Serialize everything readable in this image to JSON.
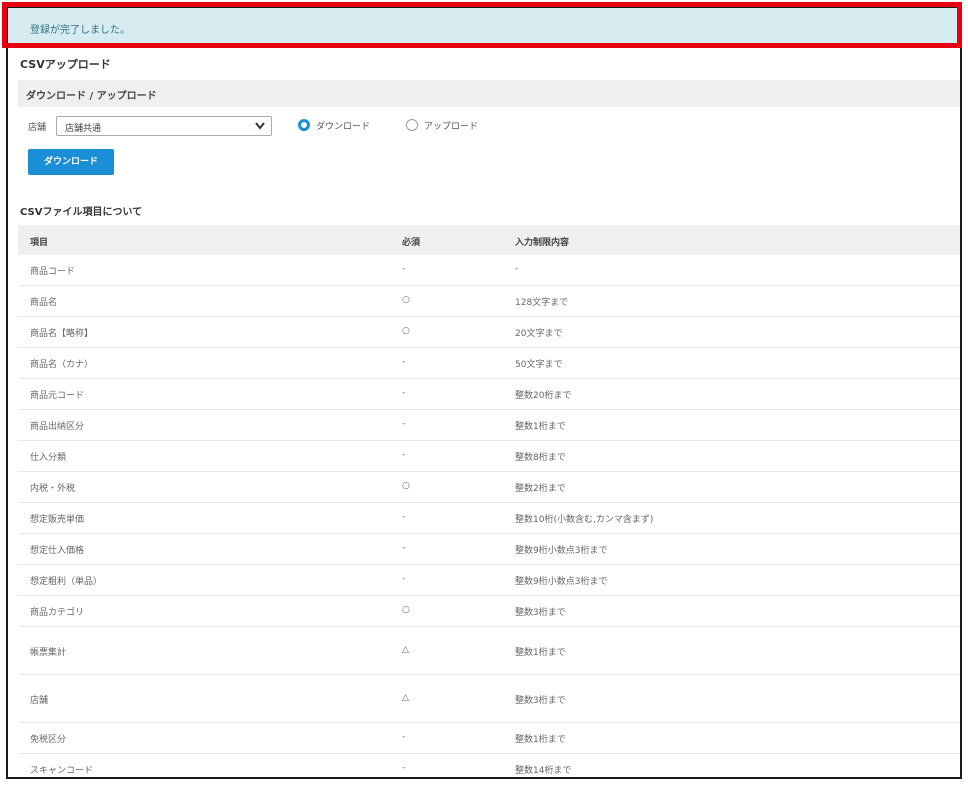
{
  "alert": {
    "message": "登録が完了しました。"
  },
  "page": {
    "title": "CSVアップロード"
  },
  "section": {
    "title": "ダウンロード / アップロード"
  },
  "controls": {
    "store_label": "店舗",
    "store_value": "店舗共通",
    "radio_download": "ダウンロード",
    "radio_upload": "アップロード",
    "selected": "download",
    "download_button": "ダウンロード"
  },
  "spec": {
    "title": "CSVファイル項目について",
    "headers": [
      "項目",
      "必須",
      "入力制限内容"
    ],
    "rows": [
      {
        "item": "商品コード",
        "req": "-",
        "limit": "-"
      },
      {
        "item": "商品名",
        "req": "○",
        "limit": "128文字まで"
      },
      {
        "item": "商品名【略称】",
        "req": "○",
        "limit": "20文字まで"
      },
      {
        "item": "商品名（カナ）",
        "req": "-",
        "limit": "50文字まで"
      },
      {
        "item": "商品元コード",
        "req": "-",
        "limit": "整数20桁まで"
      },
      {
        "item": "商品出納区分",
        "req": "-",
        "limit": "整数1桁まで"
      },
      {
        "item": "仕入分類",
        "req": "-",
        "limit": "整数8桁まで"
      },
      {
        "item": "内税・外税",
        "req": "○",
        "limit": "整数2桁まで"
      },
      {
        "item": "想定販売単価",
        "req": "-",
        "limit": "整数10桁(小数含む,カンマ含まず)"
      },
      {
        "item": "想定仕入価格",
        "req": "-",
        "limit": "整数9桁小数点3桁まで"
      },
      {
        "item": "想定粗利（単品）",
        "req": "-",
        "limit": "整数9桁小数点3桁まで"
      },
      {
        "item": "商品カテゴリ",
        "req": "○",
        "limit": "整数3桁まで"
      },
      {
        "item": "帳票集計",
        "req": "△",
        "limit": "整数1桁まで"
      },
      {
        "item": "店舗",
        "req": "△",
        "limit": "整数3桁まで"
      },
      {
        "item": "免税区分",
        "req": "-",
        "limit": "整数1桁まで"
      },
      {
        "item": "スキャンコード",
        "req": "-",
        "limit": "整数14桁まで"
      }
    ]
  }
}
